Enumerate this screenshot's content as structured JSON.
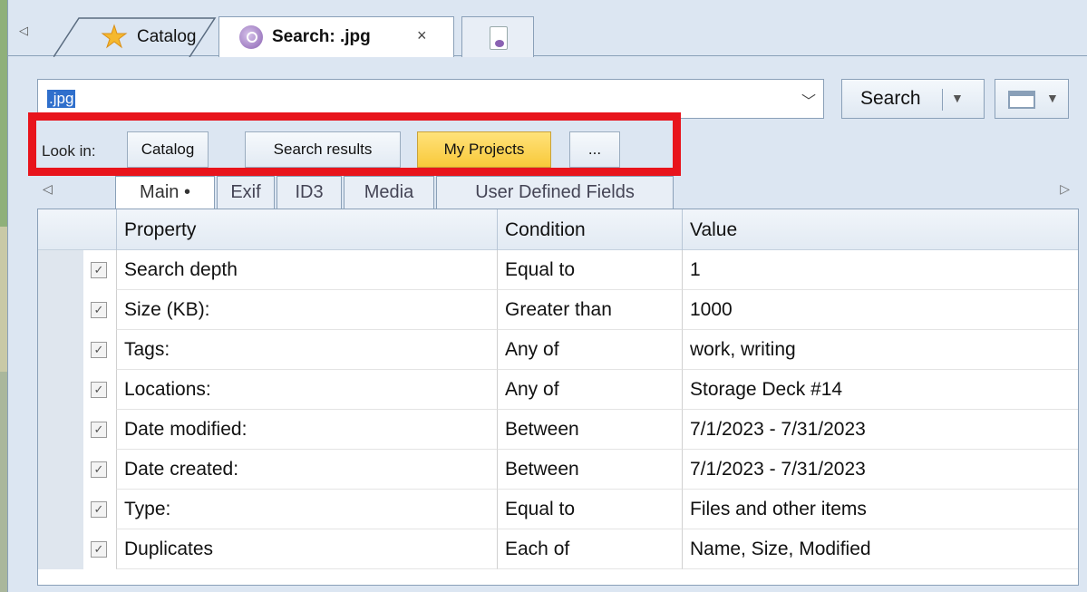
{
  "doc_tabs": {
    "catalog": "Catalog",
    "search": "Search: .jpg",
    "close": "×"
  },
  "search": {
    "query": ".jpg",
    "button": "Search"
  },
  "look_in": {
    "label": "Look in:",
    "catalog": "Catalog",
    "results": "Search results",
    "projects": "My Projects",
    "more": "..."
  },
  "criteria_tabs": {
    "main": "Main •",
    "exif": "Exif",
    "id3": "ID3",
    "media": "Media",
    "udf": "User Defined Fields"
  },
  "grid": {
    "columns": {
      "property": "Property",
      "condition": "Condition",
      "value": "Value"
    },
    "rows": [
      {
        "property": "Search depth",
        "condition": "Equal to",
        "value": "1"
      },
      {
        "property": "Size (KB):",
        "condition": "Greater than",
        "value": "1000"
      },
      {
        "property": "Tags:",
        "condition": "Any of",
        "value": "work, writing"
      },
      {
        "property": "Locations:",
        "condition": "Any of",
        "value": "Storage Deck #14"
      },
      {
        "property": "Date modified:",
        "condition": "Between",
        "value": "7/1/2023 - 7/31/2023"
      },
      {
        "property": "Date created:",
        "condition": "Between",
        "value": "7/1/2023 - 7/31/2023"
      },
      {
        "property": "Type:",
        "condition": "Equal to",
        "value": "Files and other items"
      },
      {
        "property": "Duplicates",
        "condition": "Each of",
        "value": "Name, Size, Modified"
      }
    ]
  },
  "colors": {
    "highlight_box": "#e8141c",
    "active_location": "#f8c93a",
    "selection": "#2f6fcc"
  }
}
